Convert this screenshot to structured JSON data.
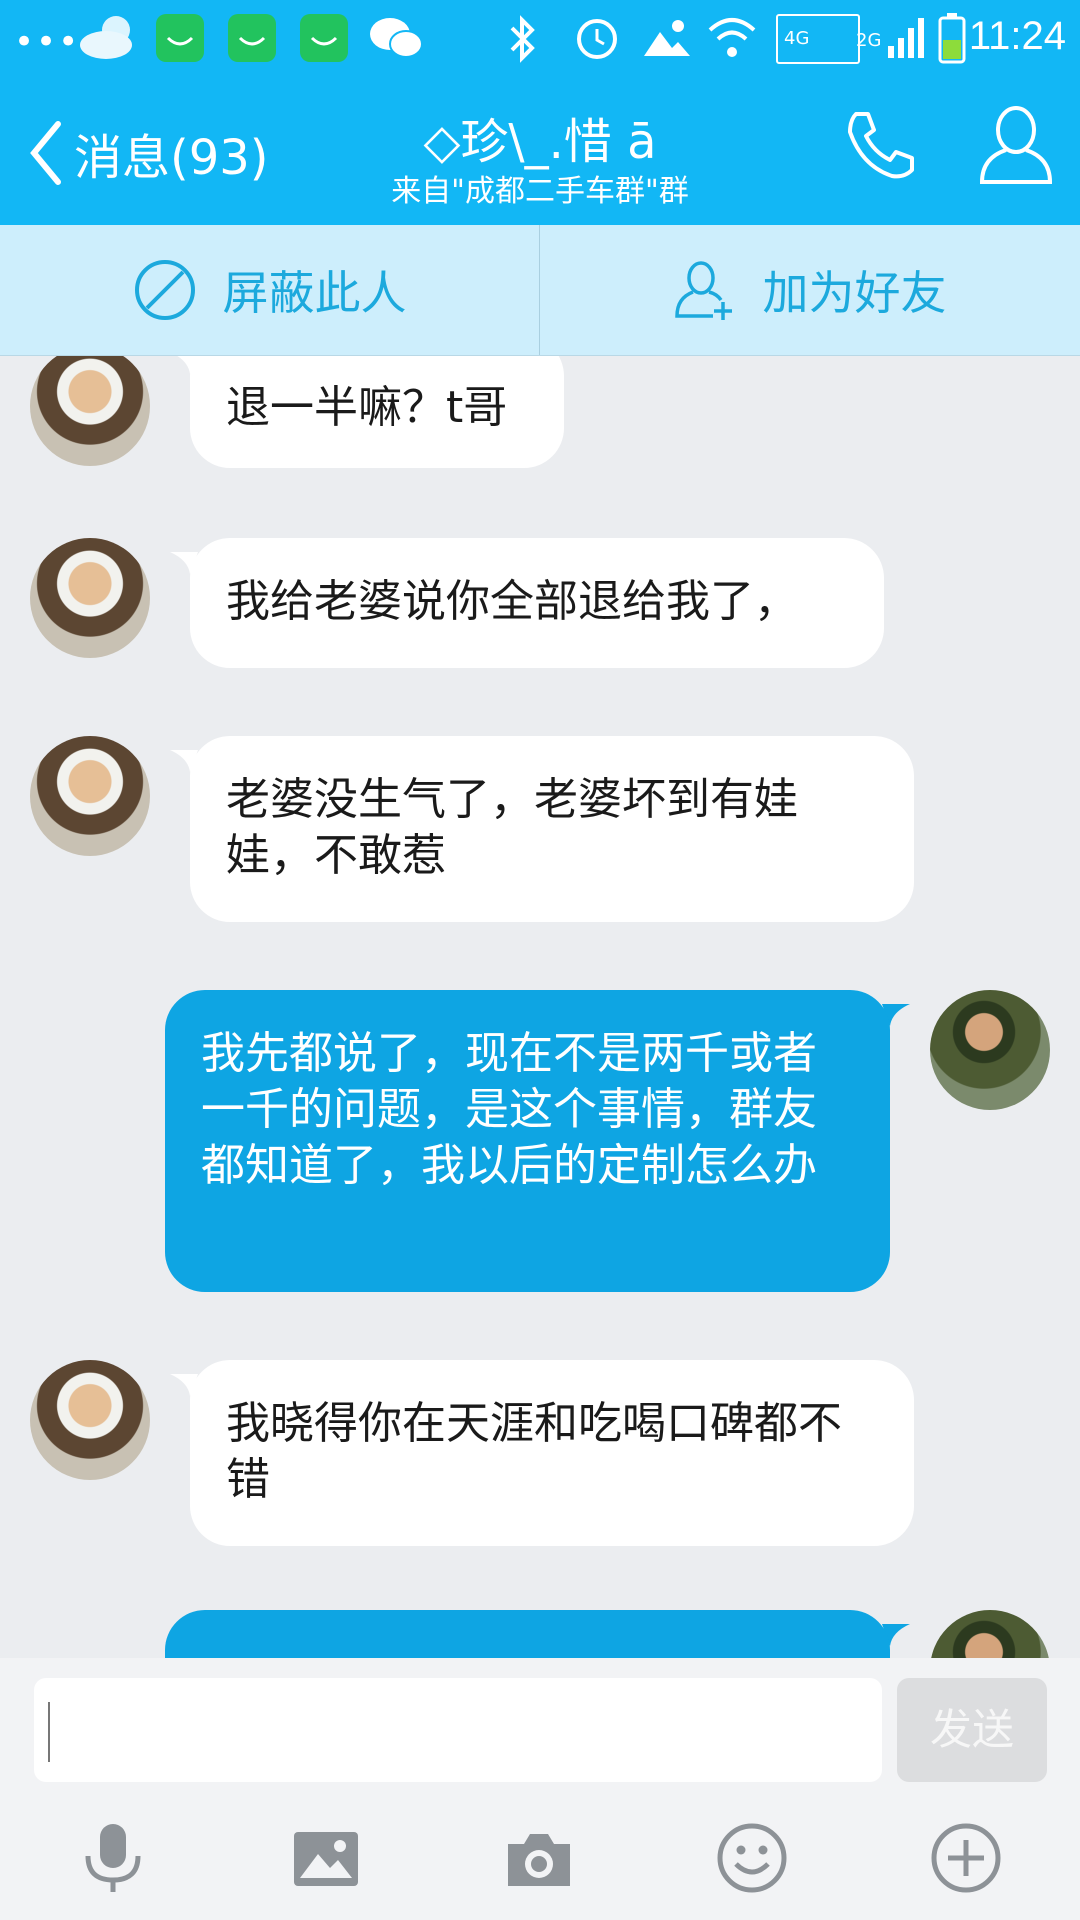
{
  "status_bar": {
    "time": "11:24",
    "network_4g": "4G",
    "network_2g": "2G",
    "icons": [
      "more-dots-icon",
      "weather-cloud-icon",
      "app-bag-icon",
      "app-bag-icon",
      "app-bag-icon",
      "wechat-icon",
      "bluetooth-icon",
      "alarm-icon",
      "photo-icon",
      "wifi-icon",
      "signal-icon",
      "battery-icon"
    ]
  },
  "header": {
    "back_label": "消息(93)",
    "title": "◇珍\\_.惜 ā",
    "subtitle": "来自\"成都二手车群\"群",
    "icons": [
      "phone-icon",
      "profile-icon"
    ]
  },
  "actions": {
    "block_label": "屏蔽此人",
    "add_friend_label": "加为好友"
  },
  "messages": [
    {
      "side": "in",
      "text": "退一半嘛？t哥"
    },
    {
      "side": "in",
      "text": "我给老婆说你全部退给我了，"
    },
    {
      "side": "in",
      "text": "老婆没生气了，老婆坏到有娃娃，不敢惹"
    },
    {
      "side": "out",
      "text": "我先都说了，现在不是两千或者一千的问题，是这个事情，群友都知道了，我以后的定制怎么办"
    },
    {
      "side": "in",
      "text": " 我晓得你在天涯和吃喝口碑都不错"
    },
    {
      "side": "out",
      "text": ""
    }
  ],
  "composer": {
    "input_value": "",
    "send_label": "发送",
    "tools": [
      "microphone-icon",
      "image-icon",
      "camera-icon",
      "emoji-icon",
      "plus-icon"
    ]
  },
  "colors": {
    "brand": "#12b7f5",
    "outgoing_bubble": "#0ea5e3",
    "incoming_bubble": "#ffffff",
    "action_strip": "#cdeefc",
    "background": "#ebedf0"
  }
}
